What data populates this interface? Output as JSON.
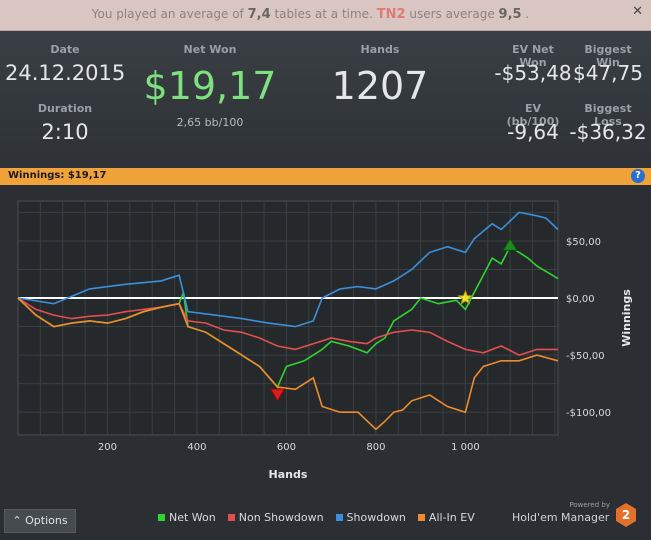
{
  "notice": {
    "prefix": "You played an average of",
    "avg_tables": "7,4",
    "mid": "tables at a time.",
    "site": "TN2",
    "users_text": "users average",
    "users_avg": "9,5",
    "suffix": ".",
    "close_label": "✕"
  },
  "stats": {
    "date_label": "Date",
    "date_value": "24.12.2015",
    "duration_label": "Duration",
    "duration_value": "2:10",
    "netwon_label": "Net Won",
    "netwon_value": "$19,17",
    "bb_value": "2,65 bb/100",
    "hands_label": "Hands",
    "hands_value": "1207",
    "ev_net_won_label": "EV Net Won",
    "ev_net_won_value": "-$53,48",
    "biggest_win_label": "Biggest Win",
    "biggest_win_value": "$47,75",
    "ev_bb_label": "EV (bb/100)",
    "ev_bb_value": "-9,64",
    "biggest_loss_label": "Biggest Loss",
    "biggest_loss_value": "-$36,32"
  },
  "winnings_bar": {
    "label": "Winnings: $19,17",
    "help": "?"
  },
  "chart_data": {
    "type": "line",
    "xlabel": "Hands",
    "ylabel": "Winnings",
    "xlim": [
      0,
      1207
    ],
    "ylim": [
      -120,
      85
    ],
    "x_ticks": [
      200,
      400,
      600,
      800,
      1000
    ],
    "x_tick_labels": [
      "200",
      "400",
      "600",
      "800",
      "1 000"
    ],
    "y_ticks": [
      50,
      0,
      -50,
      -100
    ],
    "y_tick_labels": [
      "$50,00",
      "$0,00",
      "-$50,00",
      "-$100,00"
    ],
    "series": [
      {
        "name": "Net Won",
        "color": "#2ed52e",
        "points": [
          [
            0,
            0
          ],
          [
            40,
            -15
          ],
          [
            80,
            -25
          ],
          [
            120,
            -22
          ],
          [
            160,
            -20
          ],
          [
            200,
            -22
          ],
          [
            240,
            -18
          ],
          [
            280,
            -12
          ],
          [
            320,
            -8
          ],
          [
            360,
            -5
          ],
          [
            370,
            5
          ],
          [
            380,
            -25
          ],
          [
            420,
            -30
          ],
          [
            460,
            -40
          ],
          [
            500,
            -50
          ],
          [
            540,
            -60
          ],
          [
            580,
            -78
          ],
          [
            600,
            -60
          ],
          [
            640,
            -55
          ],
          [
            660,
            -50
          ],
          [
            680,
            -45
          ],
          [
            700,
            -38
          ],
          [
            740,
            -42
          ],
          [
            780,
            -48
          ],
          [
            800,
            -40
          ],
          [
            820,
            -35
          ],
          [
            840,
            -20
          ],
          [
            860,
            -15
          ],
          [
            880,
            -10
          ],
          [
            900,
            0
          ],
          [
            940,
            -5
          ],
          [
            980,
            -2
          ],
          [
            1000,
            -10
          ],
          [
            1020,
            5
          ],
          [
            1040,
            20
          ],
          [
            1060,
            35
          ],
          [
            1080,
            30
          ],
          [
            1100,
            45
          ],
          [
            1140,
            35
          ],
          [
            1160,
            28
          ],
          [
            1207,
            17
          ]
        ]
      },
      {
        "name": "Non Showdown",
        "color": "#e14f4f",
        "points": [
          [
            0,
            0
          ],
          [
            40,
            -10
          ],
          [
            80,
            -15
          ],
          [
            120,
            -18
          ],
          [
            160,
            -16
          ],
          [
            200,
            -15
          ],
          [
            240,
            -12
          ],
          [
            280,
            -10
          ],
          [
            320,
            -8
          ],
          [
            360,
            -5
          ],
          [
            380,
            -20
          ],
          [
            420,
            -22
          ],
          [
            460,
            -28
          ],
          [
            500,
            -30
          ],
          [
            540,
            -35
          ],
          [
            580,
            -42
          ],
          [
            620,
            -45
          ],
          [
            660,
            -40
          ],
          [
            700,
            -35
          ],
          [
            740,
            -38
          ],
          [
            780,
            -40
          ],
          [
            800,
            -35
          ],
          [
            840,
            -30
          ],
          [
            880,
            -28
          ],
          [
            920,
            -30
          ],
          [
            960,
            -38
          ],
          [
            1000,
            -45
          ],
          [
            1040,
            -48
          ],
          [
            1080,
            -42
          ],
          [
            1120,
            -50
          ],
          [
            1160,
            -45
          ],
          [
            1207,
            -45
          ]
        ]
      },
      {
        "name": "Showdown",
        "color": "#3b8fdc",
        "points": [
          [
            0,
            0
          ],
          [
            80,
            -5
          ],
          [
            160,
            8
          ],
          [
            240,
            12
          ],
          [
            320,
            15
          ],
          [
            360,
            20
          ],
          [
            380,
            -12
          ],
          [
            440,
            -15
          ],
          [
            500,
            -18
          ],
          [
            560,
            -22
          ],
          [
            620,
            -25
          ],
          [
            660,
            -20
          ],
          [
            680,
            0
          ],
          [
            720,
            8
          ],
          [
            760,
            10
          ],
          [
            800,
            8
          ],
          [
            840,
            15
          ],
          [
            880,
            25
          ],
          [
            920,
            40
          ],
          [
            960,
            45
          ],
          [
            1000,
            40
          ],
          [
            1020,
            52
          ],
          [
            1060,
            65
          ],
          [
            1080,
            60
          ],
          [
            1120,
            75
          ],
          [
            1160,
            72
          ],
          [
            1180,
            70
          ],
          [
            1207,
            60
          ]
        ]
      },
      {
        "name": "All-In EV",
        "color": "#f08a2e",
        "points": [
          [
            0,
            0
          ],
          [
            40,
            -15
          ],
          [
            80,
            -25
          ],
          [
            120,
            -22
          ],
          [
            160,
            -20
          ],
          [
            200,
            -22
          ],
          [
            240,
            -18
          ],
          [
            280,
            -12
          ],
          [
            320,
            -8
          ],
          [
            360,
            -5
          ],
          [
            380,
            -25
          ],
          [
            420,
            -30
          ],
          [
            460,
            -40
          ],
          [
            500,
            -50
          ],
          [
            540,
            -60
          ],
          [
            580,
            -78
          ],
          [
            620,
            -80
          ],
          [
            660,
            -70
          ],
          [
            680,
            -95
          ],
          [
            720,
            -100
          ],
          [
            760,
            -100
          ],
          [
            800,
            -115
          ],
          [
            820,
            -108
          ],
          [
            840,
            -100
          ],
          [
            860,
            -98
          ],
          [
            880,
            -90
          ],
          [
            920,
            -85
          ],
          [
            960,
            -95
          ],
          [
            1000,
            -100
          ],
          [
            1020,
            -70
          ],
          [
            1040,
            -60
          ],
          [
            1080,
            -55
          ],
          [
            1120,
            -55
          ],
          [
            1160,
            -50
          ],
          [
            1207,
            -55
          ]
        ]
      }
    ],
    "markers": [
      {
        "label": "worst",
        "x": 580,
        "y": -85,
        "shape": "triangle-down",
        "color": "#e01a1a"
      },
      {
        "label": "best",
        "x": 1100,
        "y": 47,
        "shape": "triangle-up",
        "color": "#1f8a1f"
      },
      {
        "label": "current",
        "x": 1000,
        "y": 0,
        "shape": "star",
        "color": "#f2e12a"
      }
    ],
    "grid": true,
    "legend_position": "bottom"
  },
  "options_label": "⌃ Options",
  "brand": {
    "small": "Powered by",
    "name": "Hold'em Manager",
    "logo": "2"
  }
}
